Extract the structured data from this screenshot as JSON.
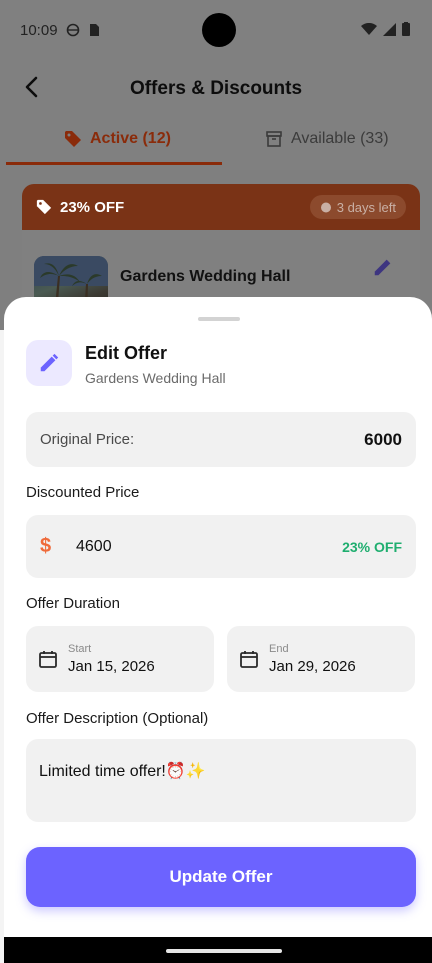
{
  "status_bar": {
    "time": "10:09"
  },
  "header": {
    "title": "Offers & Discounts"
  },
  "tabs": {
    "active": "Active (12)",
    "available": "Available (33)"
  },
  "offer_card": {
    "discount": "23% OFF",
    "days_left": "3 days left",
    "hall_name": "Gardens Wedding Hall"
  },
  "sheet": {
    "title": "Edit Offer",
    "subtitle": "Gardens Wedding Hall",
    "original_price_label": "Original Price:",
    "original_price_value": "6000",
    "discounted_label": "Discounted Price",
    "currency_symbol": "$",
    "discounted_value": "4600",
    "discount_badge": "23% OFF",
    "duration_label": "Offer Duration",
    "start_label": "Start",
    "start_value": "Jan 15, 2026",
    "end_label": "End",
    "end_value": "Jan 29, 2026",
    "description_label": "Offer Description (Optional)",
    "description_value": "Limited time offer!⏰✨",
    "update_button": "Update Offer"
  },
  "colors": {
    "accent": "#6c63ff",
    "orange": "#ef6a3a",
    "green": "#1fae6f"
  }
}
